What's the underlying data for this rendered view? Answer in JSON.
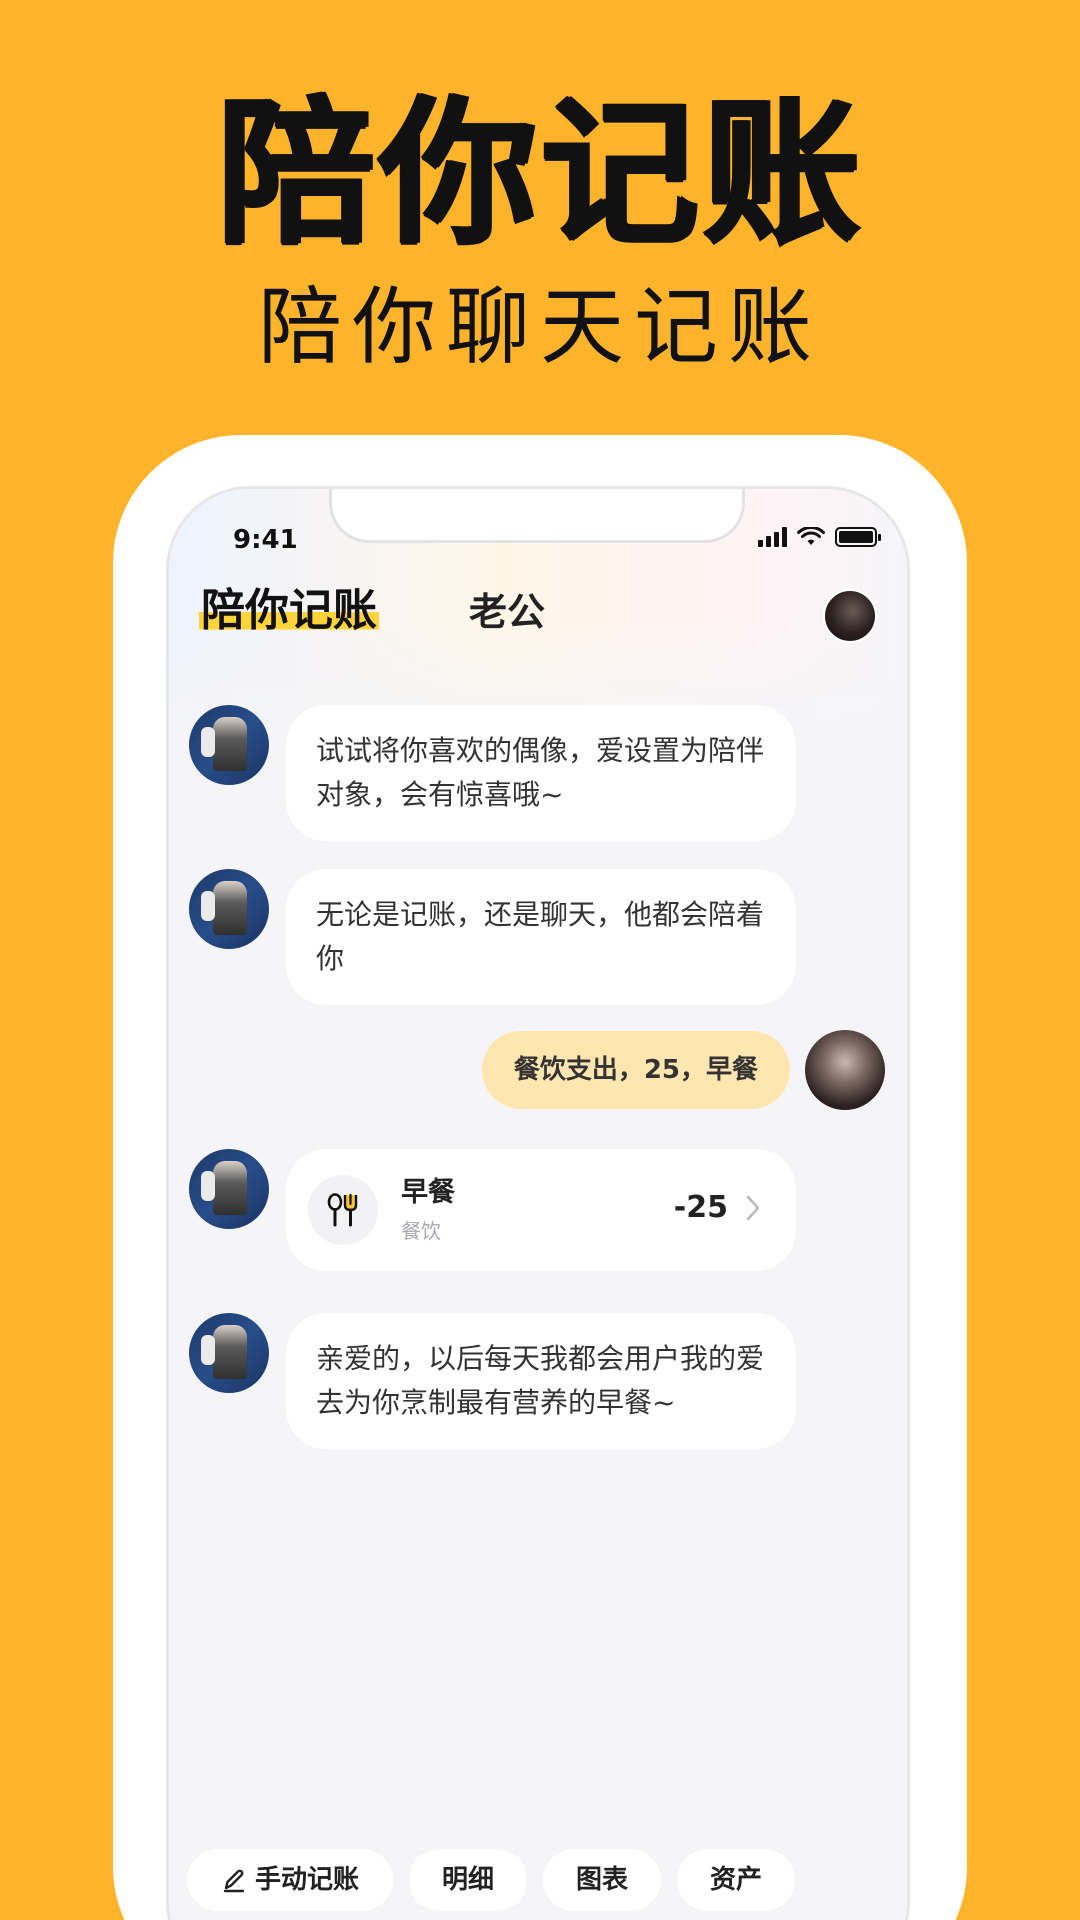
{
  "promo": {
    "title": "陪你记账",
    "subtitle": "陪你聊天记账"
  },
  "status_bar": {
    "time": "9:41",
    "icons": [
      "signal-icon",
      "wifi-icon",
      "battery-icon"
    ]
  },
  "header": {
    "app_logo": "陪你记账",
    "chat_title": "老公"
  },
  "messages": [
    {
      "sender": "bot",
      "text": "试试将你喜欢的偶像，爱设置为陪伴对象，会有惊喜哦~"
    },
    {
      "sender": "bot",
      "text": "无论是记账，还是聊天，他都会陪着你"
    },
    {
      "sender": "user",
      "text": "餐饮支出，25，早餐"
    },
    {
      "sender": "bot",
      "type": "record",
      "title": "早餐",
      "category": "餐饮",
      "amount": "-25",
      "icon": "utensils-icon"
    },
    {
      "sender": "bot",
      "text": "亲爱的，以后每天我都会用户我的爱去为你烹制最有营养的早餐~"
    }
  ],
  "bottom_bar": {
    "manual_entry": {
      "label": "手动记账",
      "icon": "pencil-icon"
    },
    "details": {
      "label": "明细"
    },
    "charts": {
      "label": "图表"
    },
    "assets": {
      "label": "资产"
    }
  },
  "colors": {
    "background": "#FDB32A",
    "logo_highlight": "#FFD43A",
    "user_bubble": "#FFE6B0",
    "screen_bg": "#F5F5F7"
  }
}
